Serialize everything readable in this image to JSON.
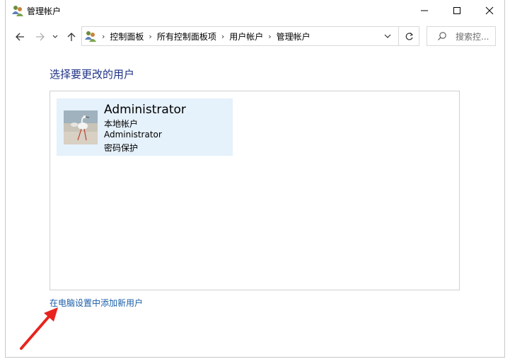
{
  "window": {
    "title": "管理帐户",
    "icon": "users-icon",
    "buttons": [
      "minimize-icon",
      "maximize-icon",
      "close-icon"
    ]
  },
  "nav": {
    "back_icon": "arrow-left-icon",
    "forward_icon": "arrow-right-icon",
    "recent_icon": "chevron-down-icon",
    "up_icon": "arrow-up-icon"
  },
  "address": {
    "icon": "users-icon",
    "separator": "›",
    "crumbs": [
      "控制面板",
      "所有控制面板项",
      "用户帐户",
      "管理帐户"
    ],
    "dropdown_icon": "chevron-down-icon",
    "refresh_icon": "refresh-icon"
  },
  "search": {
    "placeholder": "搜索控...",
    "icon": "search-icon"
  },
  "main": {
    "heading": "选择要更改的用户",
    "user": {
      "name": "Administrator",
      "type": "本地帐户",
      "group": "Administrator",
      "status": "密码保护",
      "avatar": "bird-photo-avatar"
    },
    "add_user_link": "在电脑设置中添加新用户"
  },
  "annotation": {
    "icon": "red-arrow-icon",
    "color": "#e8231e"
  },
  "colors": {
    "heading": "#1e3287",
    "link": "#1a5ea8",
    "tile_bg": "#e5f1fb"
  }
}
